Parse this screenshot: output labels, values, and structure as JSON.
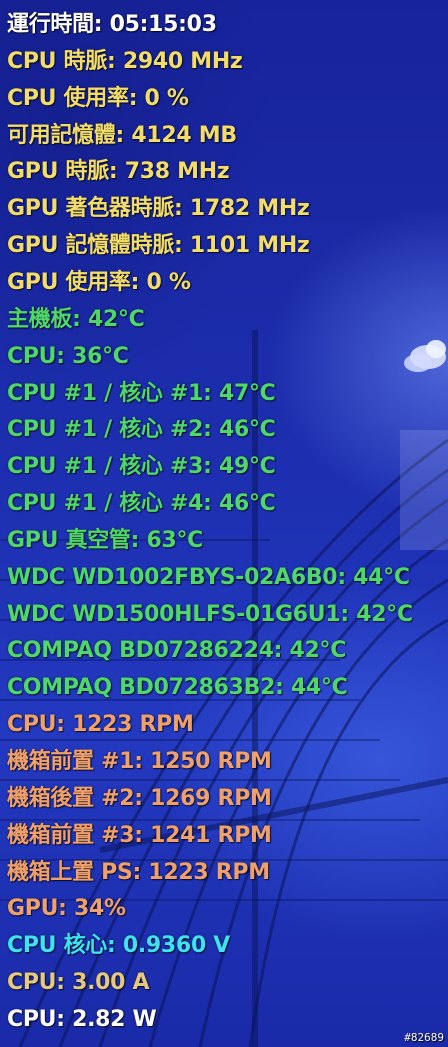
{
  "colors": {
    "white": "#ffffff",
    "yellow": "#f2dd6a",
    "green": "#4fd769",
    "orange": "#f0a06a",
    "cyan": "#3fe3f0",
    "tan": "#e6c87e"
  },
  "lines": [
    {
      "text": "運行時間: 05:15:03",
      "color": "#ffffff"
    },
    {
      "text": "CPU 時脈: 2940 MHz",
      "color": "#f2dd6a"
    },
    {
      "text": "CPU 使用率: 0 %",
      "color": "#f2dd6a"
    },
    {
      "text": "可用記憶體: 4124 MB",
      "color": "#f2dd6a"
    },
    {
      "text": "GPU 時脈: 738 MHz",
      "color": "#f2dd6a"
    },
    {
      "text": "GPU 著色器時脈: 1782 MHz",
      "color": "#f2dd6a"
    },
    {
      "text": "GPU 記憶體時脈: 1101 MHz",
      "color": "#f2dd6a"
    },
    {
      "text": "GPU 使用率: 0 %",
      "color": "#f2dd6a"
    },
    {
      "text": "主機板: 42°C",
      "color": "#4fd769"
    },
    {
      "text": "CPU: 36°C",
      "color": "#4fd769"
    },
    {
      "text": "CPU #1 / 核心 #1: 47°C",
      "color": "#4fd769"
    },
    {
      "text": "CPU #1 / 核心 #2: 46°C",
      "color": "#4fd769"
    },
    {
      "text": "CPU #1 / 核心 #3: 49°C",
      "color": "#4fd769"
    },
    {
      "text": "CPU #1 / 核心 #4: 46°C",
      "color": "#4fd769"
    },
    {
      "text": "GPU 真空管: 63°C",
      "color": "#4fd769"
    },
    {
      "text": "WDC WD1002FBYS-02A6B0: 44°C",
      "color": "#4fd769"
    },
    {
      "text": "WDC WD1500HLFS-01G6U1: 42°C",
      "color": "#4fd769"
    },
    {
      "text": "COMPAQ BD07286224: 42°C",
      "color": "#4fd769"
    },
    {
      "text": "COMPAQ BD072863B2: 44°C",
      "color": "#4fd769"
    },
    {
      "text": "CPU: 1223 RPM",
      "color": "#f0a06a"
    },
    {
      "text": "機箱前置 #1: 1250 RPM",
      "color": "#f0a06a"
    },
    {
      "text": "機箱後置 #2: 1269 RPM",
      "color": "#f0a06a"
    },
    {
      "text": "機箱前置 #3: 1241 RPM",
      "color": "#f0a06a"
    },
    {
      "text": "機箱上置 PS: 1223 RPM",
      "color": "#f0a06a"
    },
    {
      "text": "GPU: 34%",
      "color": "#f0a06a"
    },
    {
      "text": "CPU 核心: 0.9360 V",
      "color": "#3fe3f0"
    },
    {
      "text": "CPU: 3.00 A",
      "color": "#e6c87e"
    },
    {
      "text": "CPU: 2.82 W",
      "color": "#ffffff"
    }
  ],
  "watermark": "#82689"
}
